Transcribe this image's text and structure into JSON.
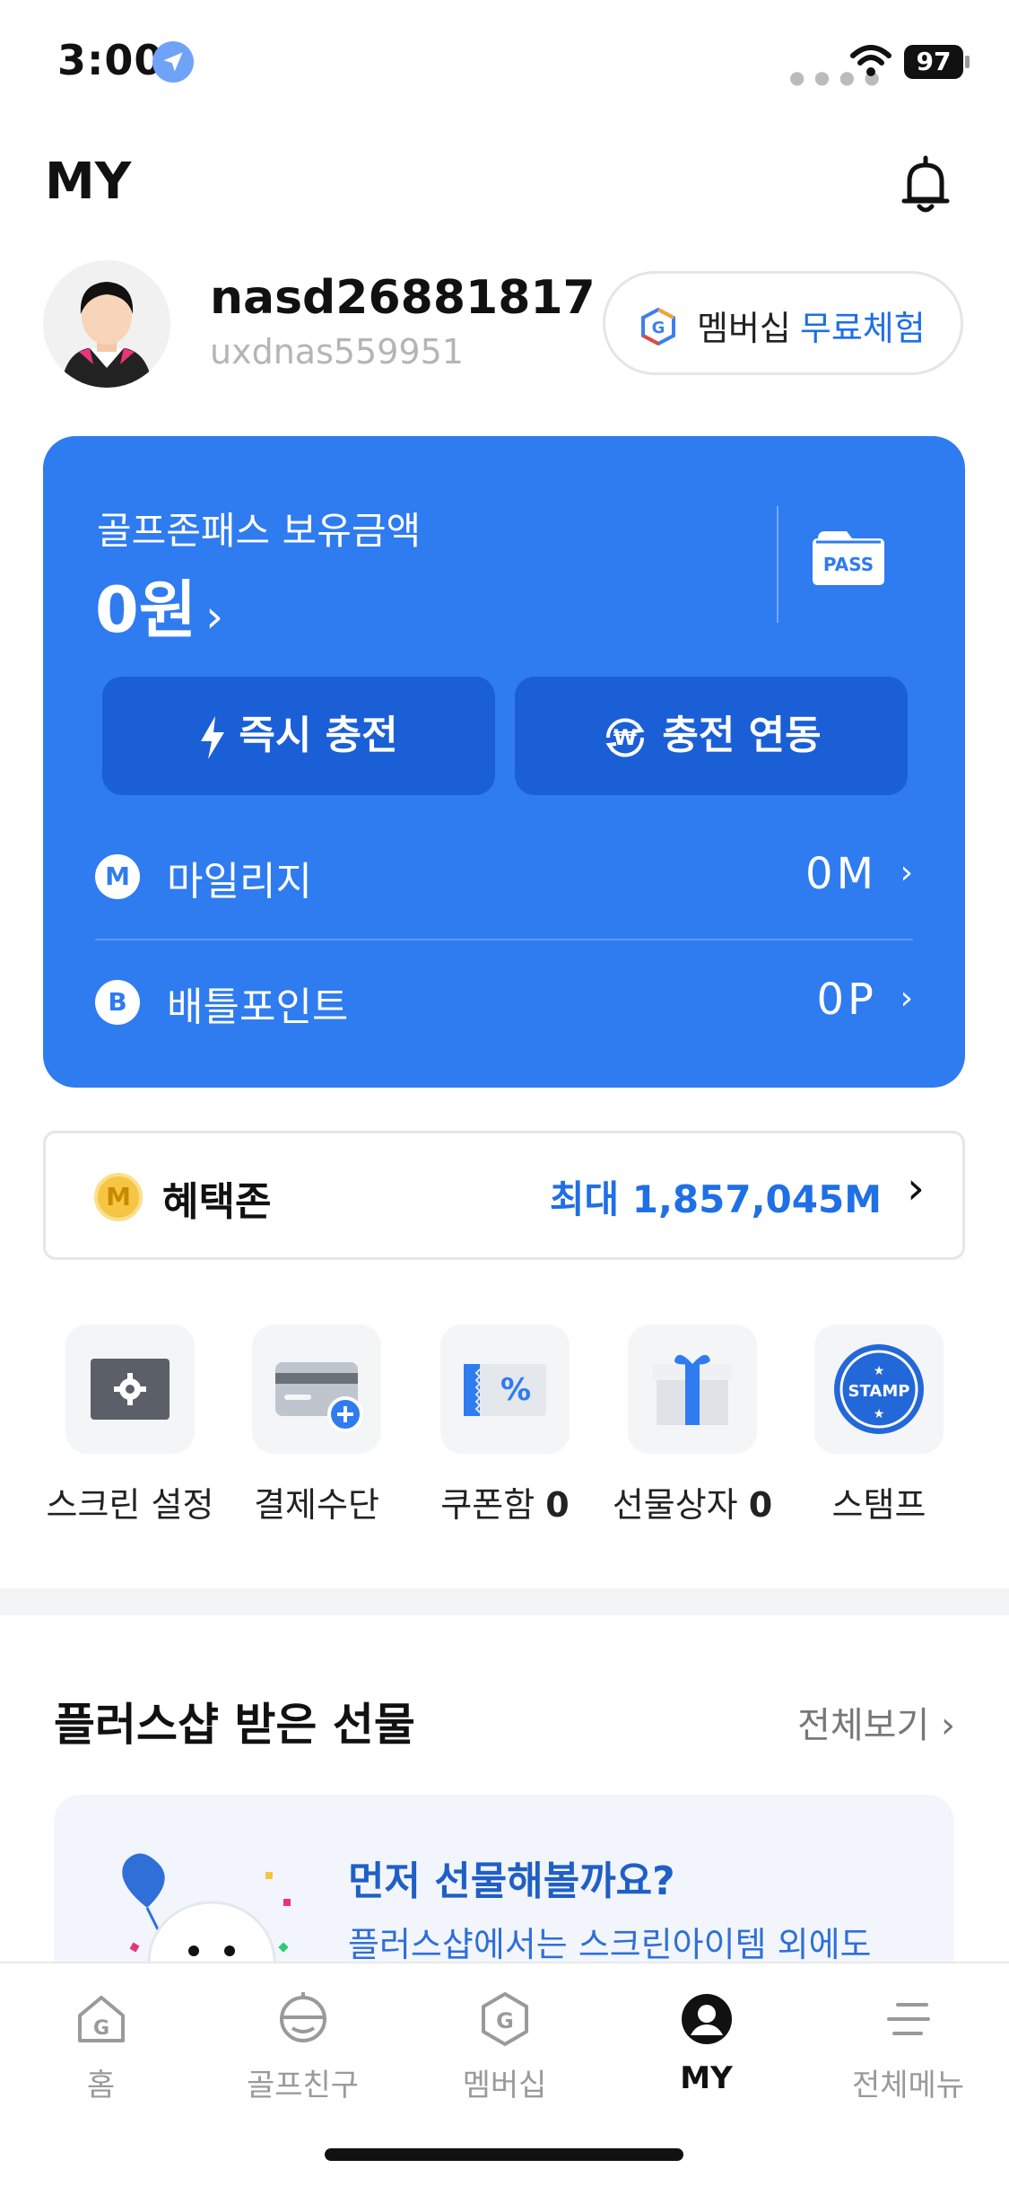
{
  "status_bar": {
    "time": "3:00",
    "battery": "97"
  },
  "header": {
    "title": "MY"
  },
  "profile": {
    "nickname": "nasd26881817",
    "user_id": "uxdnas559951",
    "membership_button": {
      "label": "멤버십",
      "highlight": "무료체험"
    }
  },
  "pass_card": {
    "label": "골프존패스 보유금액",
    "amount": "0원",
    "chevron": "›",
    "icon_text": "PASS",
    "buttons": [
      {
        "label": "즉시 충전",
        "icon": "lightning-icon"
      },
      {
        "label": "충전 연동",
        "icon": "won-sync-icon"
      }
    ],
    "rows": [
      {
        "badge": "M",
        "name": "마일리지",
        "value": "0M",
        "chevron": "›"
      },
      {
        "badge": "B",
        "name": "배틀포인트",
        "value": "0P",
        "chevron": "›"
      }
    ]
  },
  "benefit_zone": {
    "badge": "M",
    "name": "혜택존",
    "value": "최대 1,857,045M",
    "chevron": "›"
  },
  "shortcuts": [
    {
      "label": "스크린 설정",
      "count": "",
      "icon": "screen-settings-icon"
    },
    {
      "label": "결제수단",
      "count": "",
      "icon": "payment-card-icon"
    },
    {
      "label": "쿠폰함",
      "count": "0",
      "icon": "coupon-icon"
    },
    {
      "label": "선물상자",
      "count": "0",
      "icon": "gift-box-icon"
    },
    {
      "label": "스탬프",
      "count": "",
      "icon": "stamp-icon",
      "stamp_text": "STAMP"
    }
  ],
  "gifts": {
    "title": "플러스샵 받은 선물",
    "view_all": "전체보기",
    "chevron": "›",
    "card_title": "먼저 선물해볼까요?",
    "card_text": "플러스샵에서는 스크린아이템 외에도"
  },
  "tabbar": [
    {
      "label": "홈",
      "icon": "home-icon",
      "active": false
    },
    {
      "label": "골프친구",
      "icon": "golf-friend-icon",
      "active": false
    },
    {
      "label": "멤버십",
      "icon": "membership-icon",
      "active": false
    },
    {
      "label": "MY",
      "icon": "my-profile-icon",
      "active": true
    },
    {
      "label": "전체메뉴",
      "icon": "menu-icon",
      "active": false
    }
  ],
  "colors": {
    "primary": "#2f7bf0",
    "button_dark": "#1b5fd6",
    "accent_text": "#1f6fe5",
    "coin": "#f6c544"
  }
}
